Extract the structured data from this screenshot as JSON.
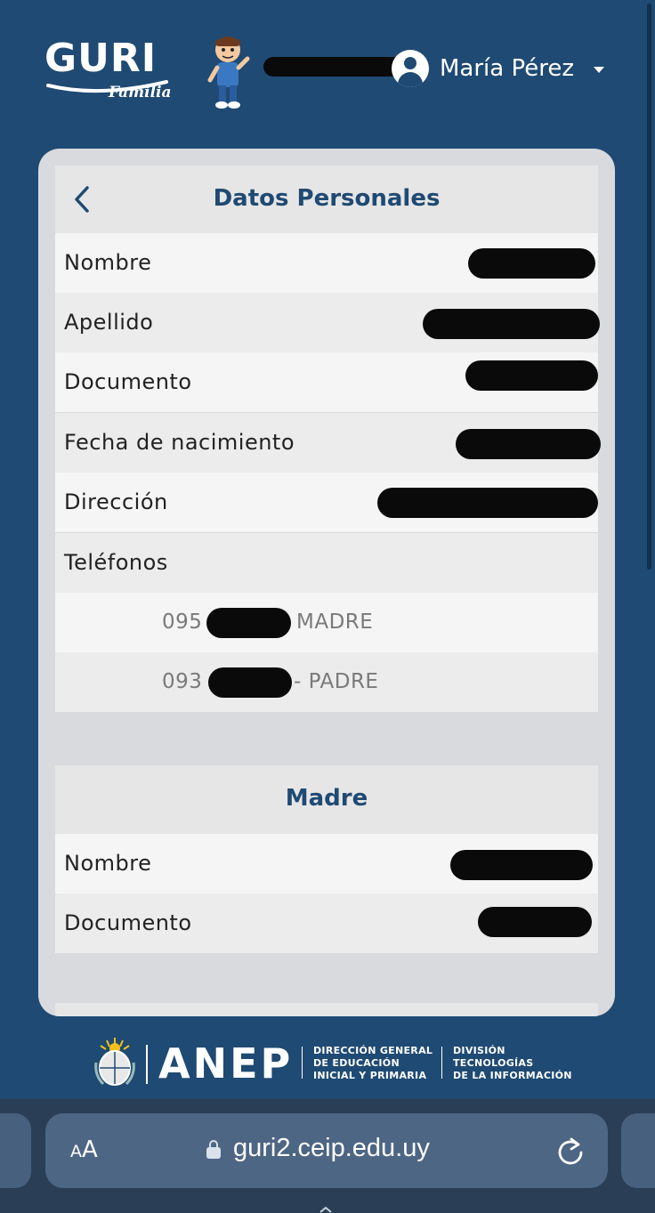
{
  "header": {
    "logo_main": "GURI",
    "logo_sub": "Familia",
    "user_name": "María Pérez"
  },
  "personal": {
    "title": "Datos Personales",
    "fields": [
      {
        "label": "Nombre"
      },
      {
        "label": "Apellido"
      },
      {
        "label": "Documento"
      },
      {
        "label": "Fecha de nacimiento"
      },
      {
        "label": "Dirección"
      },
      {
        "label": "Teléfonos"
      }
    ],
    "phones": [
      {
        "prefix": "095",
        "suffix": "MADRE"
      },
      {
        "prefix": "093",
        "suffix": "- PADRE"
      }
    ]
  },
  "madre": {
    "title": "Madre",
    "fields": [
      {
        "label": "Nombre"
      },
      {
        "label": "Documento"
      }
    ]
  },
  "footer": {
    "anep": "ANEP",
    "dgeip_lines": [
      "DIRECCIÓN GENERAL",
      "DE EDUCACIÓN",
      "INICIAL Y PRIMARIA"
    ],
    "dti_lines": [
      "DIVISIÓN",
      "TECNOLOGÍAS",
      "DE LA INFORMACIÓN"
    ]
  },
  "browser": {
    "aa_small": "A",
    "aa_large": "A",
    "url": "guri2.ceip.edu.uy"
  },
  "colors": {
    "brand": "#1f4a73",
    "card": "#d9dadd",
    "row_light": "#f5f5f5",
    "row_dark": "#ececec"
  }
}
